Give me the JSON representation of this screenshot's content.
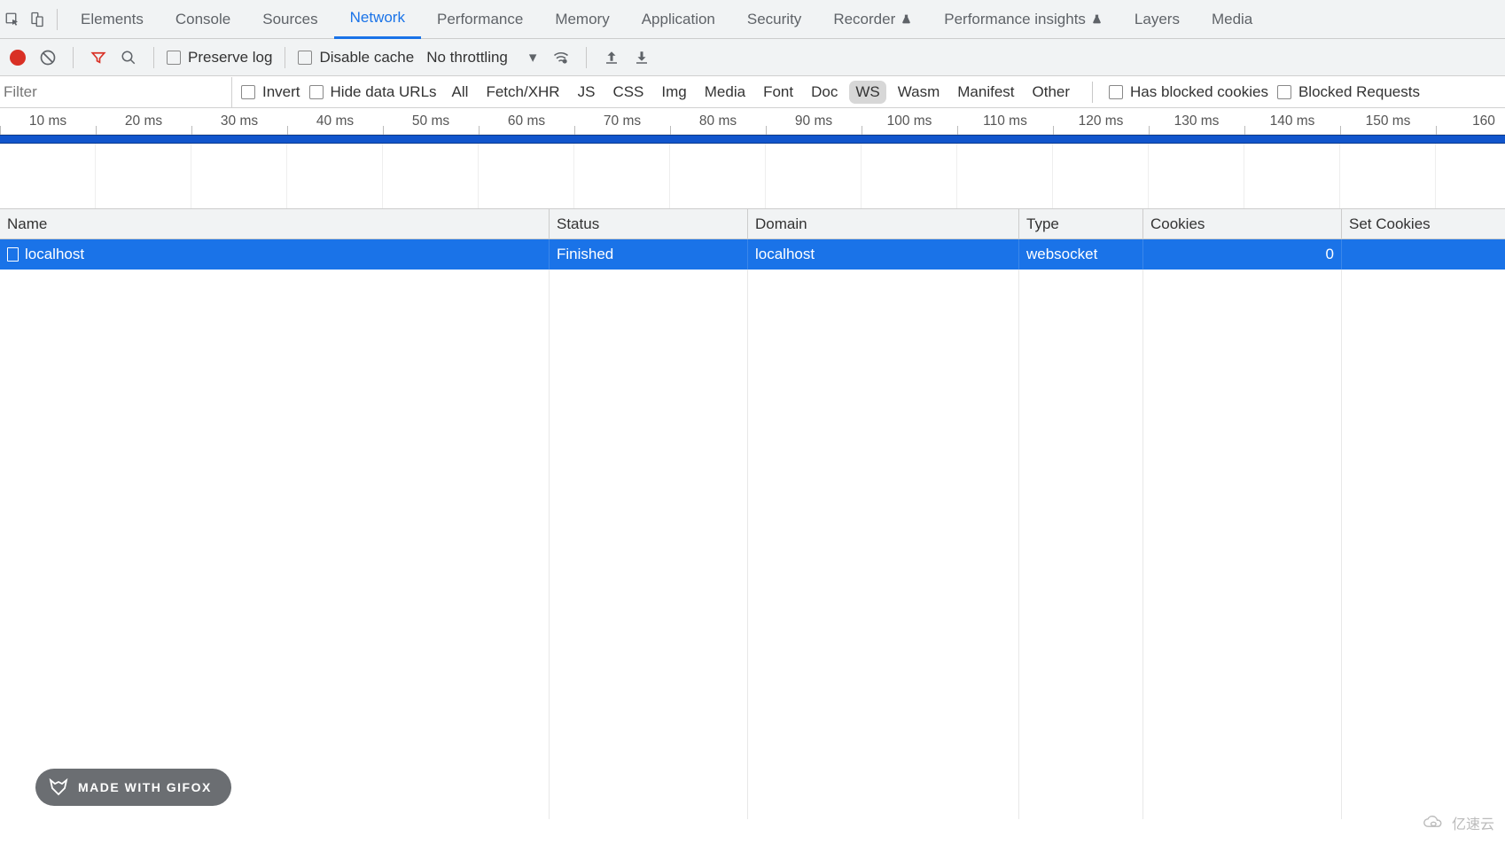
{
  "tabs": [
    "Elements",
    "Console",
    "Sources",
    "Network",
    "Performance",
    "Memory",
    "Application",
    "Security",
    "Recorder",
    "Performance insights",
    "Layers",
    "Media"
  ],
  "active_tab": "Network",
  "experimental_tabs": [
    "Recorder",
    "Performance insights"
  ],
  "toolbar": {
    "preserve_log": "Preserve log",
    "disable_cache": "Disable cache",
    "throttling": "No throttling"
  },
  "filterbar": {
    "filter_placeholder": "Filter",
    "invert": "Invert",
    "hide_data_urls": "Hide data URLs",
    "types": [
      "All",
      "Fetch/XHR",
      "JS",
      "CSS",
      "Img",
      "Media",
      "Font",
      "Doc",
      "WS",
      "Wasm",
      "Manifest",
      "Other"
    ],
    "selected_type": "WS",
    "has_blocked_cookies": "Has blocked cookies",
    "blocked_requests": "Blocked Requests"
  },
  "timeline_ticks": [
    "10 ms",
    "20 ms",
    "30 ms",
    "40 ms",
    "50 ms",
    "60 ms",
    "70 ms",
    "80 ms",
    "90 ms",
    "100 ms",
    "110 ms",
    "120 ms",
    "130 ms",
    "140 ms",
    "150 ms",
    "160"
  ],
  "columns": {
    "name": "Name",
    "status": "Status",
    "domain": "Domain",
    "type": "Type",
    "cookies": "Cookies",
    "set_cookies": "Set Cookies"
  },
  "rows": [
    {
      "name": "localhost",
      "status": "Finished",
      "domain": "localhost",
      "type": "websocket",
      "cookies": "0",
      "set_cookies": ""
    }
  ],
  "gifox_badge": "MADE WITH GIFOX",
  "watermark": "亿速云"
}
